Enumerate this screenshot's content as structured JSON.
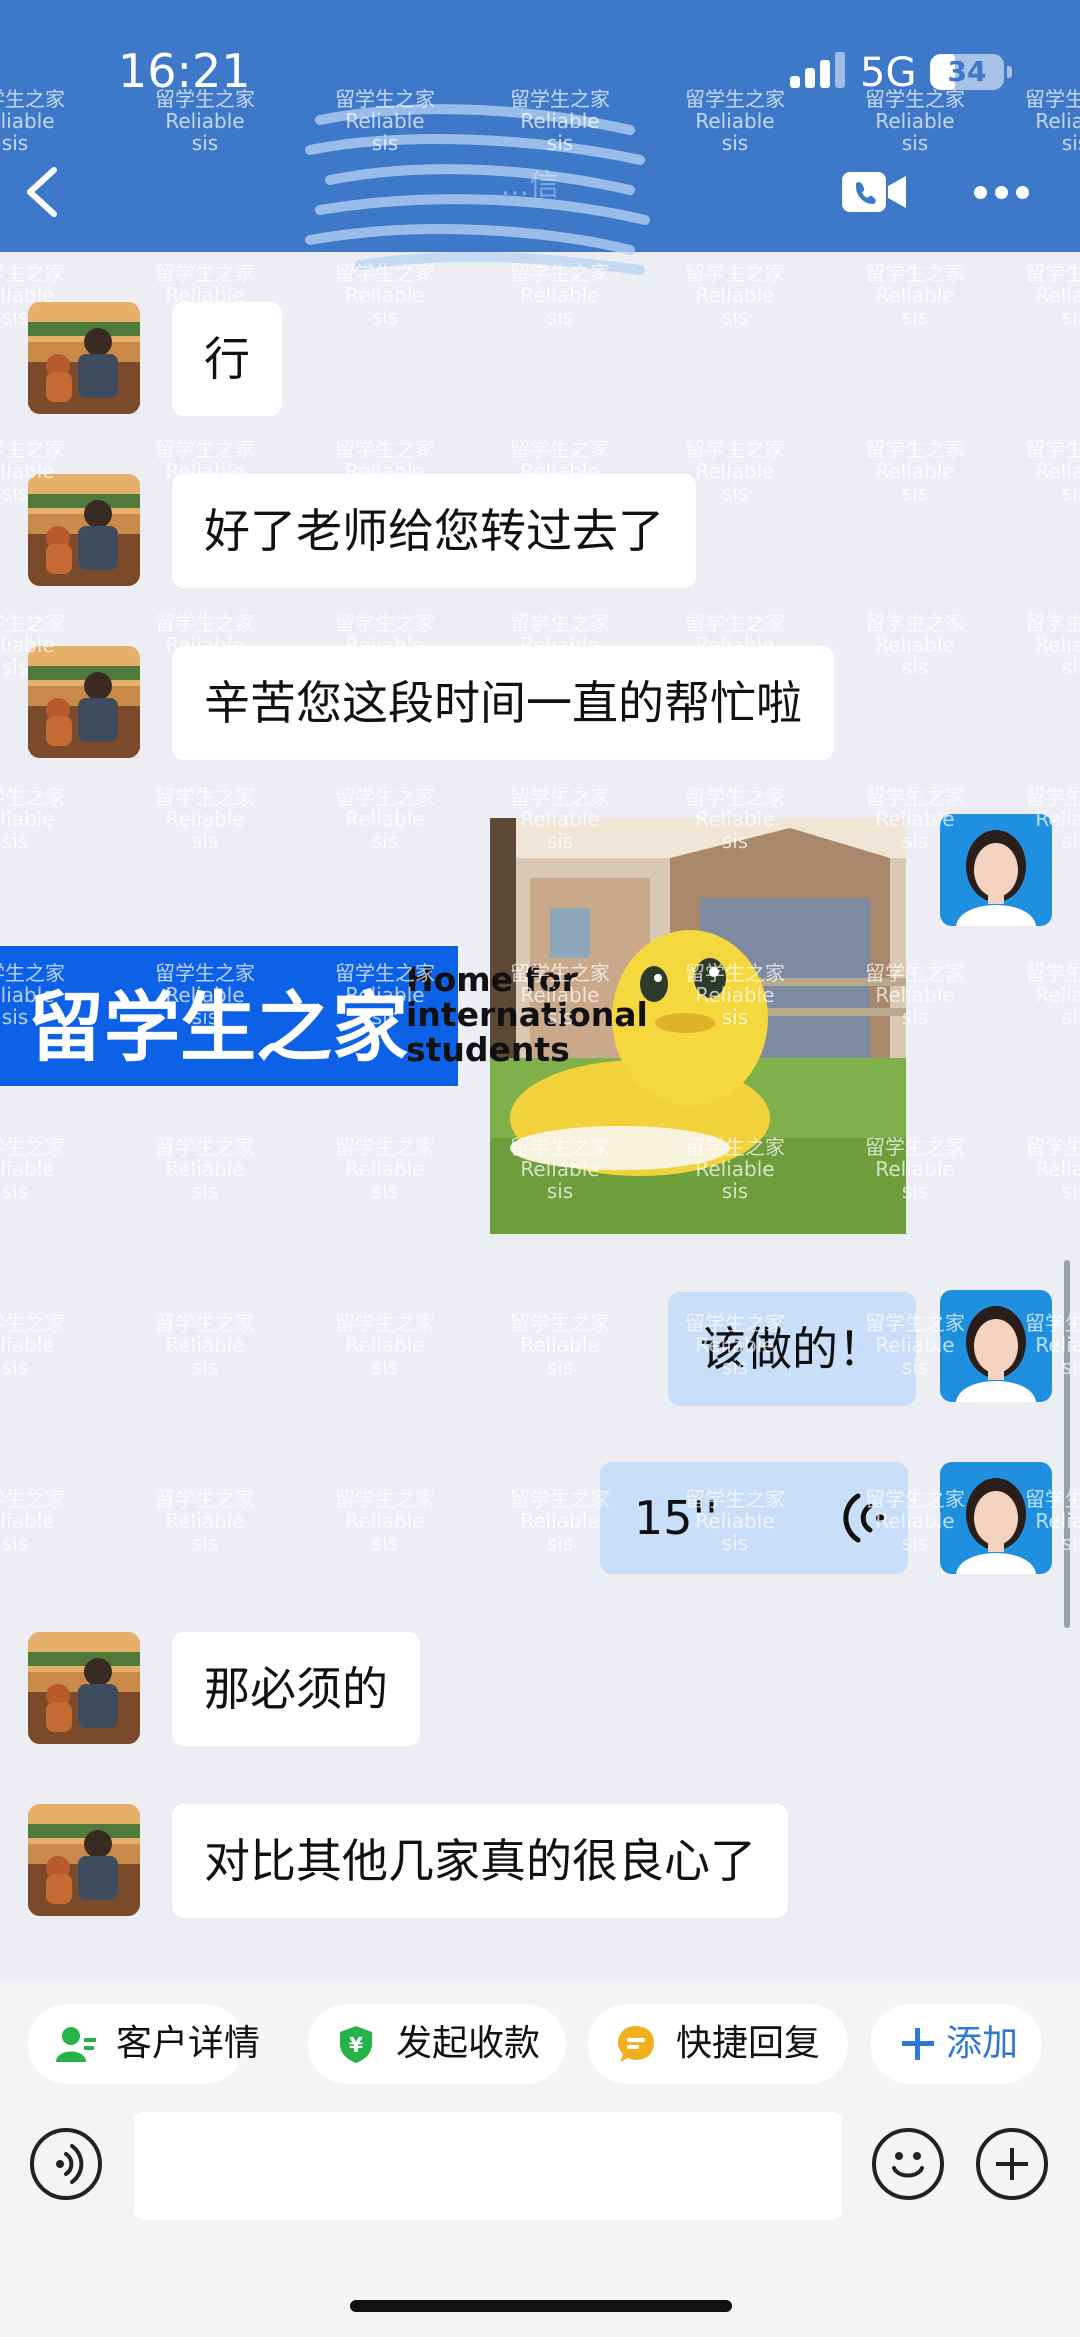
{
  "status_bar": {
    "time": "16:21",
    "network": "5G",
    "battery": "34",
    "battery_fraction": 0.34
  },
  "header": {
    "title": "...信"
  },
  "watermark": {
    "cn": "留学生之家",
    "en": "Reliable sis"
  },
  "messages": [
    {
      "direction": "in",
      "text": "行"
    },
    {
      "direction": "in",
      "text": "好了老师给您转过去了"
    },
    {
      "direction": "in",
      "text": "辛苦您这段时间一直的帮忙啦"
    },
    {
      "direction": "out",
      "type": "sticker"
    },
    {
      "direction": "out",
      "text": "该做的！"
    },
    {
      "direction": "out",
      "type": "voice",
      "duration": "15''"
    },
    {
      "direction": "in",
      "text": "那必须的"
    },
    {
      "direction": "in",
      "text": "对比其他几家真的很良心了"
    }
  ],
  "banner": {
    "cn": "留学生之家",
    "en_lines": [
      "Home for",
      "international",
      "students"
    ]
  },
  "quick_actions": [
    {
      "label": "客户详情",
      "icon": "customer-details-icon",
      "color": "#27b24a"
    },
    {
      "label": "发起收款",
      "icon": "payment-shield-icon",
      "color": "#27b24a"
    },
    {
      "label": "快捷回复",
      "icon": "quick-reply-icon",
      "color": "#f2b01e"
    },
    {
      "label": "添加",
      "icon": "plus-icon",
      "color": "#2f78d6"
    }
  ],
  "input": {
    "value": "",
    "placeholder": ""
  },
  "colors": {
    "header": "#3e78c8",
    "incoming_bubble": "#ffffff",
    "outgoing_bubble": "#c9def8",
    "accent": "#2f78d6"
  }
}
